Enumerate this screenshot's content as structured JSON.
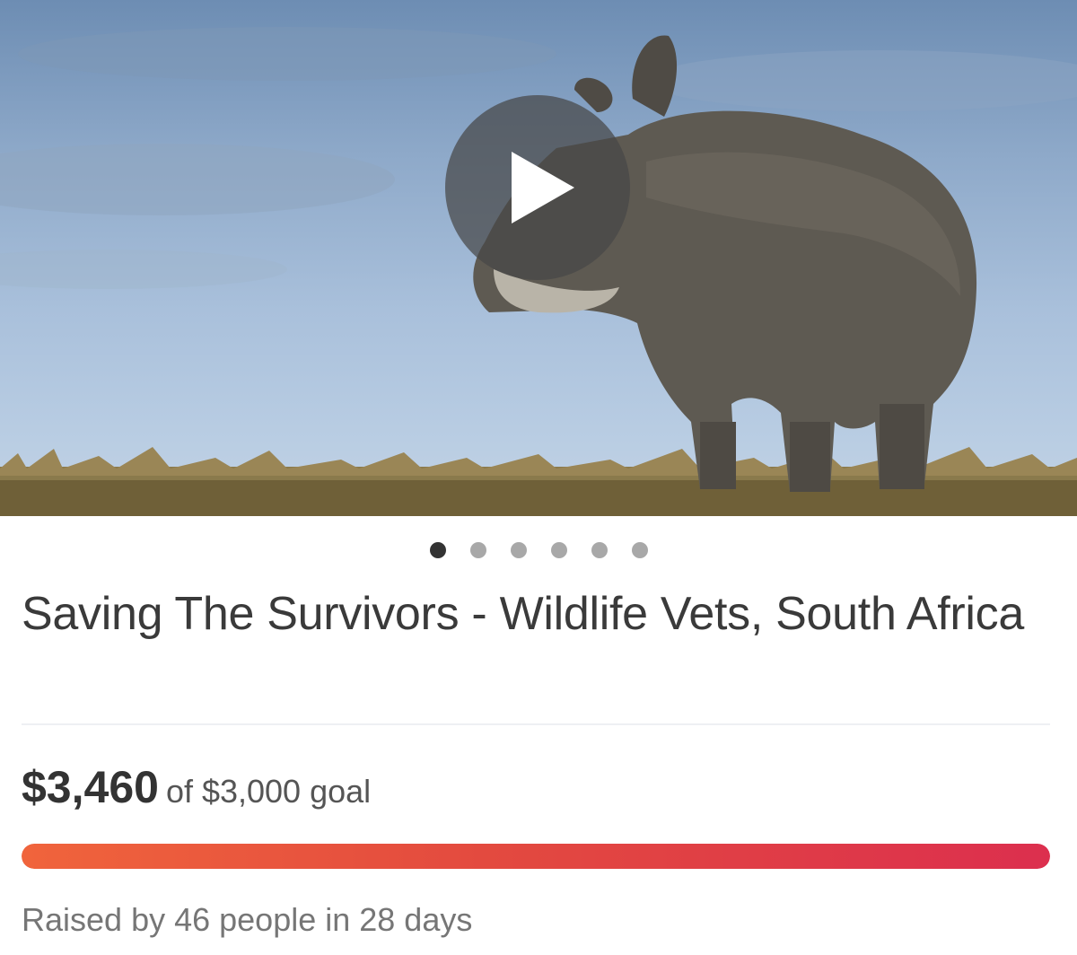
{
  "campaign": {
    "title": "Saving The Survivors - Wildlife Vets, South Africa",
    "raised": "$3,460",
    "goal_text": "of $3,000 goal",
    "progress_fraction": 1.0,
    "raised_by": "Raised by 46 people in 28 days"
  },
  "media": {
    "image_subject": "rhino-photo",
    "play_icon": "play-icon",
    "slides_total": 6,
    "active_slide": 0
  },
  "colors": {
    "progress_start": "#f0643c",
    "progress_end": "#dc2f4e",
    "dot_active": "#333333",
    "dot_inactive": "#a8a8a8"
  }
}
